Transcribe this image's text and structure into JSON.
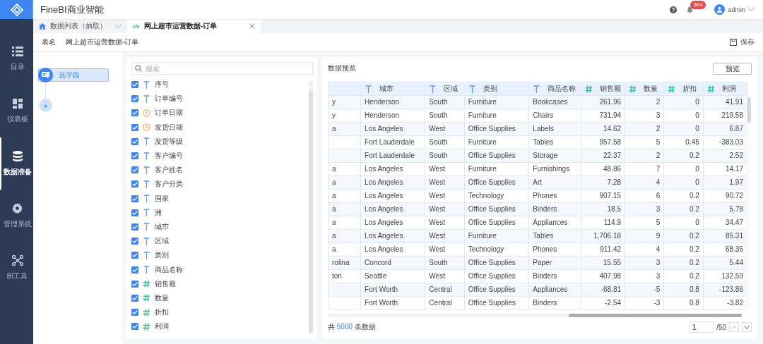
{
  "app": {
    "title": "FineBI商业智能"
  },
  "header": {
    "notification_count": "364",
    "user": "admin"
  },
  "nav": [
    {
      "label": "目录",
      "selected": false
    },
    {
      "label": "仪表板",
      "selected": false
    },
    {
      "label": "数据准备",
      "selected": true
    },
    {
      "label": "管理系统",
      "selected": false
    },
    {
      "label": "BI工具",
      "selected": false
    }
  ],
  "tabs": [
    {
      "label": "数据列表（抽取）",
      "kind": "home",
      "selected": false
    },
    {
      "label": "网上超市运营数据-订单",
      "kind": "xls",
      "selected": true
    }
  ],
  "table_name": {
    "label": "表名",
    "value": "网上超市运营数据-订单"
  },
  "save_label": "保存",
  "steps": [
    {
      "label": "选字段",
      "selected": true
    }
  ],
  "add_step": "+",
  "search": {
    "placeholder": "搜索"
  },
  "fields": [
    {
      "name": "序号",
      "kind": "text",
      "checked": true
    },
    {
      "name": "订单编号",
      "kind": "text",
      "checked": true
    },
    {
      "name": "订单日期",
      "kind": "date",
      "checked": true
    },
    {
      "name": "发货日期",
      "kind": "date",
      "checked": true
    },
    {
      "name": "发货等级",
      "kind": "text",
      "checked": true
    },
    {
      "name": "客户编号",
      "kind": "text",
      "checked": true
    },
    {
      "name": "客户姓名",
      "kind": "text",
      "checked": true
    },
    {
      "name": "客户分类",
      "kind": "text",
      "checked": true
    },
    {
      "name": "国家",
      "kind": "text",
      "checked": true
    },
    {
      "name": "洲",
      "kind": "text",
      "checked": true
    },
    {
      "name": "城市",
      "kind": "text",
      "checked": true
    },
    {
      "name": "区域",
      "kind": "text",
      "checked": true
    },
    {
      "name": "类别",
      "kind": "text",
      "checked": true
    },
    {
      "name": "商品名称",
      "kind": "text",
      "checked": true
    },
    {
      "name": "销售额",
      "kind": "number",
      "checked": true
    },
    {
      "name": "数量",
      "kind": "number",
      "checked": true
    },
    {
      "name": "折扣",
      "kind": "number",
      "checked": true
    },
    {
      "name": "利润",
      "kind": "number",
      "checked": true
    }
  ],
  "preview": {
    "title": "数据预览",
    "button": "预览",
    "columns": [
      {
        "name": "城市",
        "kind": "text"
      },
      {
        "name": "区域",
        "kind": "text"
      },
      {
        "name": "类别",
        "kind": "text"
      },
      {
        "name": "商品名称",
        "kind": "text"
      },
      {
        "name": "销售额",
        "kind": "number"
      },
      {
        "name": "数量",
        "kind": "number"
      },
      {
        "name": "折扣",
        "kind": "number"
      },
      {
        "name": "利润",
        "kind": "number"
      }
    ],
    "rows": [
      {
        "column_1": "y",
        "cells": [
          "Henderson",
          "South",
          "Furniture",
          "Bookcases",
          "261.96",
          "2",
          "0",
          "41.91"
        ]
      },
      {
        "column_1": "y",
        "cells": [
          "Henderson",
          "South",
          "Furniture",
          "Chairs",
          "731.94",
          "3",
          "0",
          "219.58"
        ]
      },
      {
        "column_1": "a",
        "cells": [
          "Los Angeles",
          "West",
          "Office Supplies",
          "Labels",
          "14.62",
          "2",
          "0",
          "6.87"
        ]
      },
      {
        "cells": [
          "Fort Lauderdale",
          "South",
          "Furniture",
          "Tables",
          "957.58",
          "5",
          "0.45",
          "-383.03"
        ]
      },
      {
        "cells": [
          "Fort Lauderdale",
          "South",
          "Office Supplies",
          "Storage",
          "22.37",
          "2",
          "0.2",
          "2.52"
        ]
      },
      {
        "column_1": "a",
        "cells": [
          "Los Angeles",
          "West",
          "Furniture",
          "Furnishings",
          "48.86",
          "7",
          "0",
          "14.17"
        ]
      },
      {
        "column_1": "a",
        "cells": [
          "Los Angeles",
          "West",
          "Office Supplies",
          "Art",
          "7.28",
          "4",
          "0",
          "1.97"
        ]
      },
      {
        "column_1": "a",
        "cells": [
          "Los Angeles",
          "West",
          "Technology",
          "Phones",
          "907.15",
          "6",
          "0.2",
          "90.72"
        ]
      },
      {
        "column_1": "a",
        "cells": [
          "Los Angeles",
          "West",
          "Office Supplies",
          "Binders",
          "18.5",
          "3",
          "0.2",
          "5.78"
        ]
      },
      {
        "column_1": "a",
        "cells": [
          "Los Angeles",
          "West",
          "Office Supplies",
          "Appliances",
          "114.9",
          "5",
          "0",
          "34.47"
        ]
      },
      {
        "column_1": "a",
        "cells": [
          "Los Angeles",
          "West",
          "Furniture",
          "Tables",
          "1,706.18",
          "9",
          "0.2",
          "85.31"
        ]
      },
      {
        "column_1": "a",
        "cells": [
          "Los Angeles",
          "West",
          "Technology",
          "Phones",
          "911.42",
          "4",
          "0.2",
          "68.36"
        ]
      },
      {
        "column_1": "rolina",
        "cells": [
          "Concord",
          "South",
          "Office Supplies",
          "Paper",
          "15.55",
          "3",
          "0.2",
          "5.44"
        ]
      },
      {
        "column_1": "ton",
        "cells": [
          "Seattle",
          "West",
          "Office Supplies",
          "Binders",
          "407.98",
          "3",
          "0.2",
          "132.59"
        ]
      },
      {
        "cells": [
          "Fort Worth",
          "Central",
          "Office Supplies",
          "Appliances",
          "-68.81",
          "-5",
          "0.8",
          "-123.86"
        ]
      },
      {
        "cells": [
          "Fort Worth",
          "Central",
          "Office Supplies",
          "Binders",
          "-2.54",
          "-3",
          "0.8",
          "-3.82"
        ]
      }
    ],
    "footer": {
      "prefix": "共",
      "count": "5000",
      "suffix": "条数据",
      "page": "1",
      "pages": "/50"
    }
  }
}
